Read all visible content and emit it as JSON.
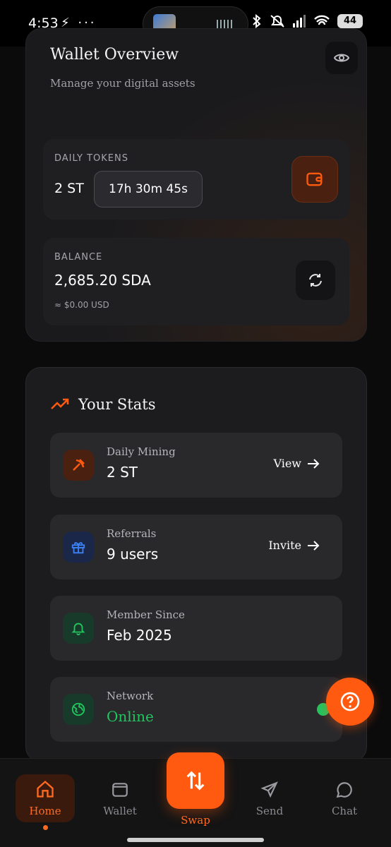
{
  "status_bar": {
    "time": "4:53",
    "left_icons": "⚡ ···",
    "battery": "44"
  },
  "overview": {
    "title": "Wallet Overview",
    "subtitle": "Manage your digital assets",
    "tokens_label": "DAILY TOKENS",
    "tokens_value": "2 ST",
    "timer": "17h 30m 45s",
    "balance_label": "BALANCE",
    "balance_value": "2,685.20 SDA",
    "balance_usd": "≈ $0.00 USD"
  },
  "stats": {
    "title": "Your Stats",
    "rows": [
      {
        "label": "Daily Mining",
        "value": "2 ST",
        "action": "View",
        "icon": "pickaxe-icon"
      },
      {
        "label": "Referrals",
        "value": "9 users",
        "action": "Invite",
        "icon": "gift-icon"
      },
      {
        "label": "Member Since",
        "value": "Feb 2025",
        "action": "",
        "icon": "bell-icon"
      },
      {
        "label": "Network",
        "value": "Online",
        "action": "",
        "icon": "globe-icon"
      }
    ]
  },
  "colors": {
    "accent": "#ff5a0f",
    "online": "#22c55e"
  },
  "nav": {
    "home": "Home",
    "wallet": "Wallet",
    "swap": "Swap",
    "send": "Send",
    "chat": "Chat"
  }
}
